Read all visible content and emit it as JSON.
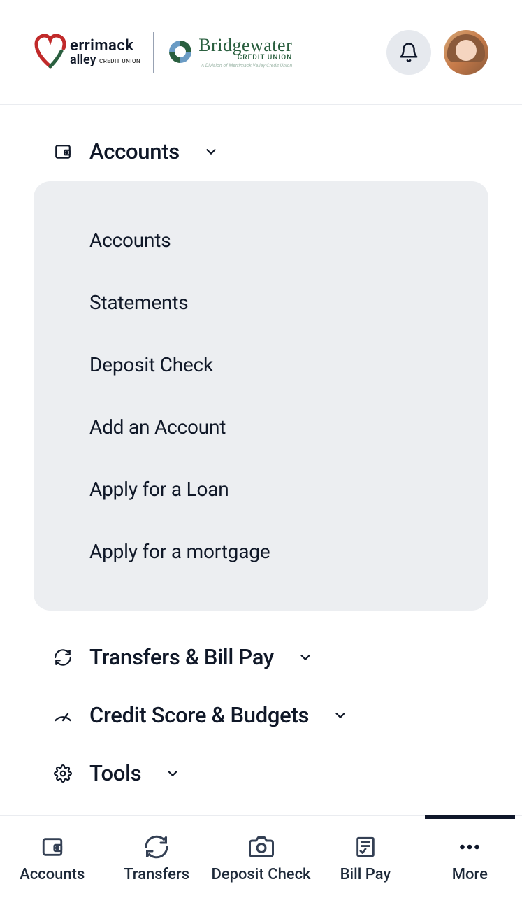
{
  "logo": {
    "mv_line1": "errimack",
    "mv_line2": "alley",
    "mv_sub": "CREDIT UNION",
    "bw_name": "Bridgewater",
    "bw_sub1": "CREDIT UNION",
    "bw_sub2": "A Division of Merrimack Valley Credit Union"
  },
  "menu": {
    "accounts": {
      "title": "Accounts",
      "items": [
        "Accounts",
        "Statements",
        "Deposit Check",
        "Add an Account",
        "Apply for a Loan",
        "Apply for a mortgage"
      ]
    },
    "transfers": {
      "title": "Transfers & Bill Pay"
    },
    "credit": {
      "title": "Credit Score & Budgets"
    },
    "tools": {
      "title": "Tools"
    }
  },
  "nav": {
    "accounts": "Accounts",
    "transfers": "Transfers",
    "deposit": "Deposit Check",
    "billpay": "Bill Pay",
    "more": "More"
  }
}
